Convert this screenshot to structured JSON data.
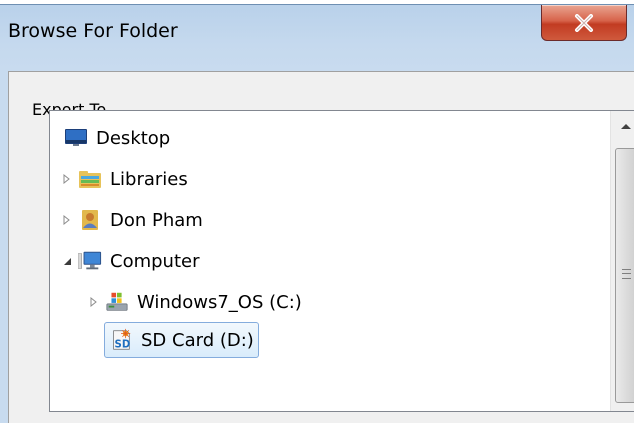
{
  "dialog": {
    "title": "Browse For Folder",
    "prompt": "Export To",
    "close_button": "close-x"
  },
  "tree": {
    "items": [
      {
        "label": "Desktop",
        "icon": "desktop-icon",
        "expander": "none",
        "selected": false
      },
      {
        "label": "Libraries",
        "icon": "libraries-icon",
        "expander": "collapsed",
        "selected": false
      },
      {
        "label": "Don Pham",
        "icon": "user-folder-icon",
        "expander": "collapsed",
        "selected": false
      },
      {
        "label": "Computer",
        "icon": "computer-icon",
        "expander": "expanded",
        "selected": false
      },
      {
        "label": "Windows7_OS (C:)",
        "icon": "hard-drive-icon",
        "expander": "collapsed",
        "selected": false
      },
      {
        "label": "SD Card (D:)",
        "icon": "sd-card-icon",
        "expander": "none",
        "selected": true
      }
    ]
  },
  "colors": {
    "titlebar": "#b9d1ea",
    "close_button": "#c23b22",
    "selection_fill": "#d9ecfb",
    "selection_border": "#84acdd"
  }
}
